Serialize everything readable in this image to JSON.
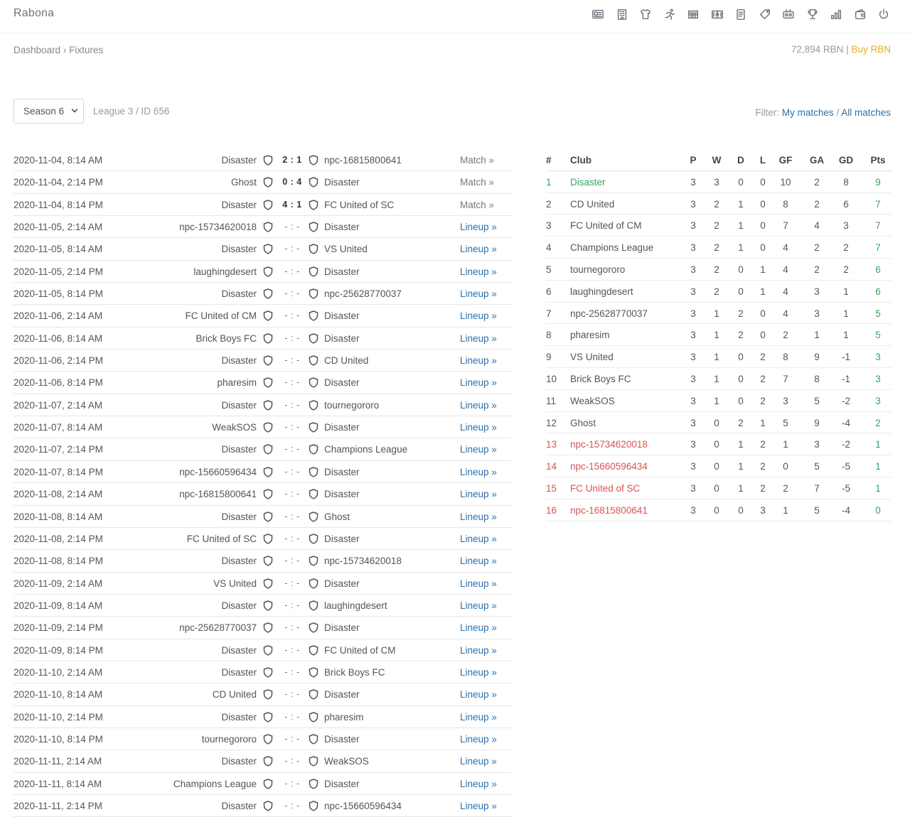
{
  "brand": "Rabona",
  "icons": [
    "news-icon",
    "building-icon",
    "shirt-icon",
    "runner-icon",
    "stadium-icon",
    "pitch-icon",
    "document-icon",
    "tag-icon",
    "scoreboard-icon",
    "trophy-icon",
    "bar-chart-icon",
    "wallet-icon",
    "power-icon"
  ],
  "breadcrumb": {
    "home": "Dashboard",
    "sep": "›",
    "current": "Fixtures"
  },
  "balance": {
    "amount": "72,894 RBN",
    "sep": "|",
    "buy": "Buy RBN"
  },
  "season": {
    "selected": "Season 6"
  },
  "league_info": "League 3 / ID 656",
  "filter": {
    "label": "Filter:",
    "my": "My matches",
    "sep": "/",
    "all": "All matches"
  },
  "colors": {
    "green": "#3aa35a",
    "red": "#d9534f",
    "link": "#2c6fa8",
    "gold": "#e0ad2e"
  },
  "fixtures": [
    {
      "date": "2020-11-04, 8:14 AM",
      "home": "Disaster",
      "score": "2 : 1",
      "away": "npc-16815800641",
      "link": "Match »",
      "played": true
    },
    {
      "date": "2020-11-04, 2:14 PM",
      "home": "Ghost",
      "score": "0 : 4",
      "away": "Disaster",
      "link": "Match »",
      "played": true
    },
    {
      "date": "2020-11-04, 8:14 PM",
      "home": "Disaster",
      "score": "4 : 1",
      "away": "FC United of SC",
      "link": "Match »",
      "played": true
    },
    {
      "date": "2020-11-05, 2:14 AM",
      "home": "npc-15734620018",
      "score": "- : -",
      "away": "Disaster",
      "link": "Lineup »",
      "played": false
    },
    {
      "date": "2020-11-05, 8:14 AM",
      "home": "Disaster",
      "score": "- : -",
      "away": "VS United",
      "link": "Lineup »",
      "played": false
    },
    {
      "date": "2020-11-05, 2:14 PM",
      "home": "laughingdesert",
      "score": "- : -",
      "away": "Disaster",
      "link": "Lineup »",
      "played": false
    },
    {
      "date": "2020-11-05, 8:14 PM",
      "home": "Disaster",
      "score": "- : -",
      "away": "npc-25628770037",
      "link": "Lineup »",
      "played": false
    },
    {
      "date": "2020-11-06, 2:14 AM",
      "home": "FC United of CM",
      "score": "- : -",
      "away": "Disaster",
      "link": "Lineup »",
      "played": false
    },
    {
      "date": "2020-11-06, 8:14 AM",
      "home": "Brick Boys FC",
      "score": "- : -",
      "away": "Disaster",
      "link": "Lineup »",
      "played": false
    },
    {
      "date": "2020-11-06, 2:14 PM",
      "home": "Disaster",
      "score": "- : -",
      "away": "CD United",
      "link": "Lineup »",
      "played": false
    },
    {
      "date": "2020-11-06, 8:14 PM",
      "home": "pharesim",
      "score": "- : -",
      "away": "Disaster",
      "link": "Lineup »",
      "played": false
    },
    {
      "date": "2020-11-07, 2:14 AM",
      "home": "Disaster",
      "score": "- : -",
      "away": "tournegororo",
      "link": "Lineup »",
      "played": false
    },
    {
      "date": "2020-11-07, 8:14 AM",
      "home": "WeakSOS",
      "score": "- : -",
      "away": "Disaster",
      "link": "Lineup »",
      "played": false
    },
    {
      "date": "2020-11-07, 2:14 PM",
      "home": "Disaster",
      "score": "- : -",
      "away": "Champions League",
      "link": "Lineup »",
      "played": false
    },
    {
      "date": "2020-11-07, 8:14 PM",
      "home": "npc-15660596434",
      "score": "- : -",
      "away": "Disaster",
      "link": "Lineup »",
      "played": false
    },
    {
      "date": "2020-11-08, 2:14 AM",
      "home": "npc-16815800641",
      "score": "- : -",
      "away": "Disaster",
      "link": "Lineup »",
      "played": false
    },
    {
      "date": "2020-11-08, 8:14 AM",
      "home": "Disaster",
      "score": "- : -",
      "away": "Ghost",
      "link": "Lineup »",
      "played": false
    },
    {
      "date": "2020-11-08, 2:14 PM",
      "home": "FC United of SC",
      "score": "- : -",
      "away": "Disaster",
      "link": "Lineup »",
      "played": false
    },
    {
      "date": "2020-11-08, 8:14 PM",
      "home": "Disaster",
      "score": "- : -",
      "away": "npc-15734620018",
      "link": "Lineup »",
      "played": false
    },
    {
      "date": "2020-11-09, 2:14 AM",
      "home": "VS United",
      "score": "- : -",
      "away": "Disaster",
      "link": "Lineup »",
      "played": false
    },
    {
      "date": "2020-11-09, 8:14 AM",
      "home": "Disaster",
      "score": "- : -",
      "away": "laughingdesert",
      "link": "Lineup »",
      "played": false
    },
    {
      "date": "2020-11-09, 2:14 PM",
      "home": "npc-25628770037",
      "score": "- : -",
      "away": "Disaster",
      "link": "Lineup »",
      "played": false
    },
    {
      "date": "2020-11-09, 8:14 PM",
      "home": "Disaster",
      "score": "- : -",
      "away": "FC United of CM",
      "link": "Lineup »",
      "played": false
    },
    {
      "date": "2020-11-10, 2:14 AM",
      "home": "Disaster",
      "score": "- : -",
      "away": "Brick Boys FC",
      "link": "Lineup »",
      "played": false
    },
    {
      "date": "2020-11-10, 8:14 AM",
      "home": "CD United",
      "score": "- : -",
      "away": "Disaster",
      "link": "Lineup »",
      "played": false
    },
    {
      "date": "2020-11-10, 2:14 PM",
      "home": "Disaster",
      "score": "- : -",
      "away": "pharesim",
      "link": "Lineup »",
      "played": false
    },
    {
      "date": "2020-11-10, 8:14 PM",
      "home": "tournegororo",
      "score": "- : -",
      "away": "Disaster",
      "link": "Lineup »",
      "played": false
    },
    {
      "date": "2020-11-11, 2:14 AM",
      "home": "Disaster",
      "score": "- : -",
      "away": "WeakSOS",
      "link": "Lineup »",
      "played": false
    },
    {
      "date": "2020-11-11, 8:14 AM",
      "home": "Champions League",
      "score": "- : -",
      "away": "Disaster",
      "link": "Lineup »",
      "played": false
    },
    {
      "date": "2020-11-11, 2:14 PM",
      "home": "Disaster",
      "score": "- : -",
      "away": "npc-15660596434",
      "link": "Lineup »",
      "played": false
    }
  ],
  "standings": {
    "headers": {
      "rank": "#",
      "club": "Club",
      "p": "P",
      "w": "W",
      "d": "D",
      "l": "L",
      "gf": "GF",
      "ga": "GA",
      "gd": "GD",
      "pts": "Pts"
    },
    "rows": [
      {
        "rank": "1",
        "club": "Disaster",
        "p": "3",
        "w": "3",
        "d": "0",
        "l": "0",
        "gf": "10",
        "ga": "2",
        "gd": "8",
        "pts": "9",
        "status": "promotion"
      },
      {
        "rank": "2",
        "club": "CD United",
        "p": "3",
        "w": "2",
        "d": "1",
        "l": "0",
        "gf": "8",
        "ga": "2",
        "gd": "6",
        "pts": "7",
        "status": ""
      },
      {
        "rank": "3",
        "club": "FC United of CM",
        "p": "3",
        "w": "2",
        "d": "1",
        "l": "0",
        "gf": "7",
        "ga": "4",
        "gd": "3",
        "pts": "7",
        "status": ""
      },
      {
        "rank": "4",
        "club": "Champions League",
        "p": "3",
        "w": "2",
        "d": "1",
        "l": "0",
        "gf": "4",
        "ga": "2",
        "gd": "2",
        "pts": "7",
        "status": ""
      },
      {
        "rank": "5",
        "club": "tournegororo",
        "p": "3",
        "w": "2",
        "d": "0",
        "l": "1",
        "gf": "4",
        "ga": "2",
        "gd": "2",
        "pts": "6",
        "status": ""
      },
      {
        "rank": "6",
        "club": "laughingdesert",
        "p": "3",
        "w": "2",
        "d": "0",
        "l": "1",
        "gf": "4",
        "ga": "3",
        "gd": "1",
        "pts": "6",
        "status": ""
      },
      {
        "rank": "7",
        "club": "npc-25628770037",
        "p": "3",
        "w": "1",
        "d": "2",
        "l": "0",
        "gf": "4",
        "ga": "3",
        "gd": "1",
        "pts": "5",
        "status": ""
      },
      {
        "rank": "8",
        "club": "pharesim",
        "p": "3",
        "w": "1",
        "d": "2",
        "l": "0",
        "gf": "2",
        "ga": "1",
        "gd": "1",
        "pts": "5",
        "status": ""
      },
      {
        "rank": "9",
        "club": "VS United",
        "p": "3",
        "w": "1",
        "d": "0",
        "l": "2",
        "gf": "8",
        "ga": "9",
        "gd": "-1",
        "pts": "3",
        "status": ""
      },
      {
        "rank": "10",
        "club": "Brick Boys FC",
        "p": "3",
        "w": "1",
        "d": "0",
        "l": "2",
        "gf": "7",
        "ga": "8",
        "gd": "-1",
        "pts": "3",
        "status": ""
      },
      {
        "rank": "11",
        "club": "WeakSOS",
        "p": "3",
        "w": "1",
        "d": "0",
        "l": "2",
        "gf": "3",
        "ga": "5",
        "gd": "-2",
        "pts": "3",
        "status": ""
      },
      {
        "rank": "12",
        "club": "Ghost",
        "p": "3",
        "w": "0",
        "d": "2",
        "l": "1",
        "gf": "5",
        "ga": "9",
        "gd": "-4",
        "pts": "2",
        "status": ""
      },
      {
        "rank": "13",
        "club": "npc-15734620018",
        "p": "3",
        "w": "0",
        "d": "1",
        "l": "2",
        "gf": "1",
        "ga": "3",
        "gd": "-2",
        "pts": "1",
        "status": "relegation"
      },
      {
        "rank": "14",
        "club": "npc-15660596434",
        "p": "3",
        "w": "0",
        "d": "1",
        "l": "2",
        "gf": "0",
        "ga": "5",
        "gd": "-5",
        "pts": "1",
        "status": "relegation"
      },
      {
        "rank": "15",
        "club": "FC United of SC",
        "p": "3",
        "w": "0",
        "d": "1",
        "l": "2",
        "gf": "2",
        "ga": "7",
        "gd": "-5",
        "pts": "1",
        "status": "relegation"
      },
      {
        "rank": "16",
        "club": "npc-16815800641",
        "p": "3",
        "w": "0",
        "d": "0",
        "l": "3",
        "gf": "1",
        "ga": "5",
        "gd": "-4",
        "pts": "0",
        "status": "relegation"
      }
    ]
  }
}
